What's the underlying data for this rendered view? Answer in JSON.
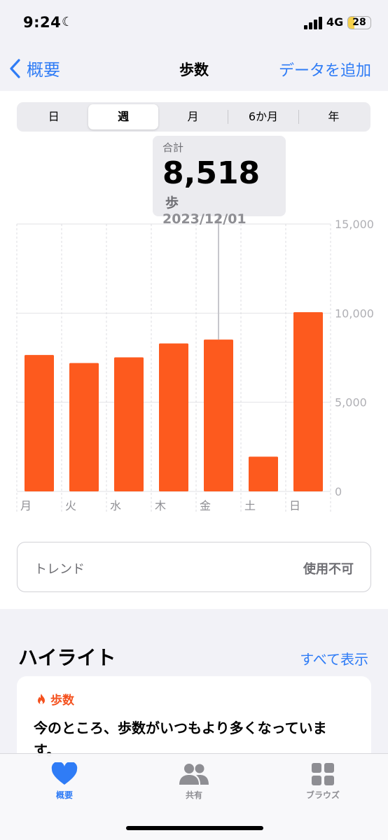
{
  "status": {
    "time": "9:24",
    "network": "4G",
    "battery": "28",
    "battery_level": 0.28
  },
  "nav": {
    "back_label": "概要",
    "title": "歩数",
    "add_label": "データを追加"
  },
  "segments": {
    "options": [
      "日",
      "週",
      "月",
      "6か月",
      "年"
    ],
    "selected": "週"
  },
  "tooltip": {
    "label": "合計",
    "value": "8,518",
    "unit": "歩",
    "date": "2023/12/01"
  },
  "chart_data": {
    "type": "bar",
    "categories": [
      "月",
      "火",
      "水",
      "木",
      "金",
      "土",
      "日"
    ],
    "values": [
      7650,
      7200,
      7520,
      8300,
      8518,
      1950,
      10050
    ],
    "ylim": [
      0,
      15000
    ],
    "yticks": [
      "0",
      "5,000",
      "10,000",
      "15,000"
    ],
    "highlight_index": 4,
    "bar_color": "#fd5a1e",
    "grid": true
  },
  "trend": {
    "label": "トレンド",
    "status": "使用不可"
  },
  "highlights": {
    "title": "ハイライト",
    "show_all": "すべて表示",
    "card": {
      "tag": "歩数",
      "text": "今のところ、歩数がいつもより多くなっています。"
    }
  },
  "tabbar": {
    "items": [
      {
        "label": "概要",
        "icon": "heart-icon",
        "active": true
      },
      {
        "label": "共有",
        "icon": "people-icon",
        "active": false
      },
      {
        "label": "ブラウズ",
        "icon": "grid-icon",
        "active": false
      }
    ]
  },
  "colors": {
    "accent": "#2f7cf6",
    "bar": "#fd5a1e",
    "tag": "#f4511e"
  }
}
